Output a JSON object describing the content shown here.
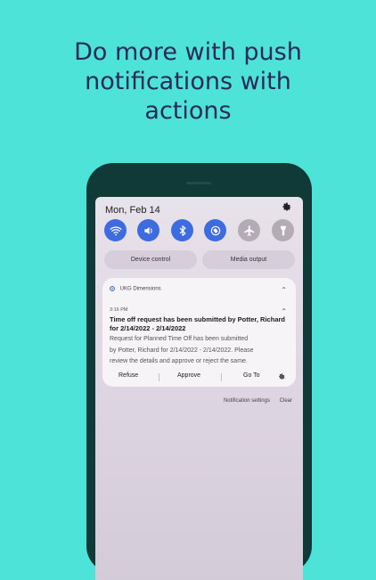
{
  "headline": {
    "line1": "Do more with push",
    "line2": "notifications with",
    "line3": "actions"
  },
  "status_bar": {
    "date": "Mon, Feb 14"
  },
  "quick_settings": {
    "tiles": [
      {
        "icon": "wifi-icon",
        "state": "on"
      },
      {
        "icon": "volume-icon",
        "state": "on"
      },
      {
        "icon": "bluetooth-icon",
        "state": "on"
      },
      {
        "icon": "auto-rotate-icon",
        "state": "on"
      },
      {
        "icon": "airplane-icon",
        "state": "off"
      },
      {
        "icon": "flashlight-icon",
        "state": "off"
      }
    ],
    "device_control": "Device control",
    "media_output": "Media output"
  },
  "notification": {
    "app_name": "UKG Dimensions",
    "time": "3:16 PM",
    "title_line1": "Time off request has been submitted by Potter, Richard",
    "title_line2": "for 2/14/2022 - 2/14/2022",
    "body_line1": "Request for Planned Time Off has been submitted",
    "body_line2": "by Potter, Richard for 2/14/2022 - 2/14/2022. Please",
    "body_line3": "review the details and approve or reject the same.",
    "actions": {
      "refuse": "Refuse",
      "approve": "Approve",
      "go_to": "Go To"
    }
  },
  "footer": {
    "settings_link": "Notification settings",
    "clear_link": "Clear"
  },
  "colors": {
    "background": "#4de3d8",
    "headline": "#2b2b5a",
    "phone_body": "#0f3a37",
    "tile_on": "#3d6be0",
    "tile_off": "#b3acb7"
  }
}
